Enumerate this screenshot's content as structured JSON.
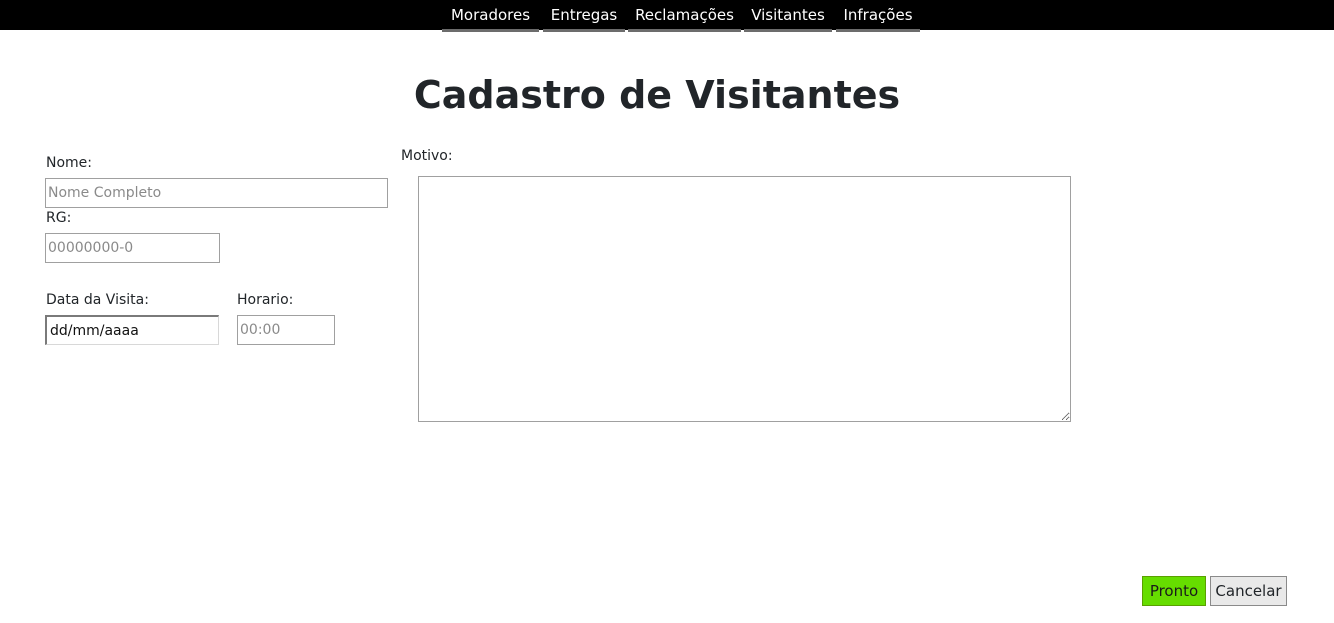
{
  "nav": {
    "items": [
      {
        "label": "Moradores"
      },
      {
        "label": "Entregas"
      },
      {
        "label": "Reclamações"
      },
      {
        "label": "Visitantes"
      },
      {
        "label": "Infrações"
      }
    ]
  },
  "page": {
    "title": "Cadastro de Visitantes"
  },
  "form": {
    "nome": {
      "label": "Nome:",
      "placeholder": "Nome Completo",
      "value": ""
    },
    "rg": {
      "label": "RG:",
      "placeholder": "00000000-0",
      "value": ""
    },
    "data_visita": {
      "label": "Data da Visita:",
      "value": "dd/mm/aaaa"
    },
    "horario": {
      "label": "Horario:",
      "placeholder": "00:00",
      "value": ""
    },
    "motivo": {
      "label": "Motivo:",
      "value": ""
    }
  },
  "actions": {
    "pronto_label": "Pronto",
    "cancelar_label": "Cancelar"
  },
  "colors": {
    "nav_background": "#000000",
    "nav_underline": "#6c6c6c",
    "pronto_background": "#66dd00",
    "cancelar_background": "#e9e9e9"
  }
}
